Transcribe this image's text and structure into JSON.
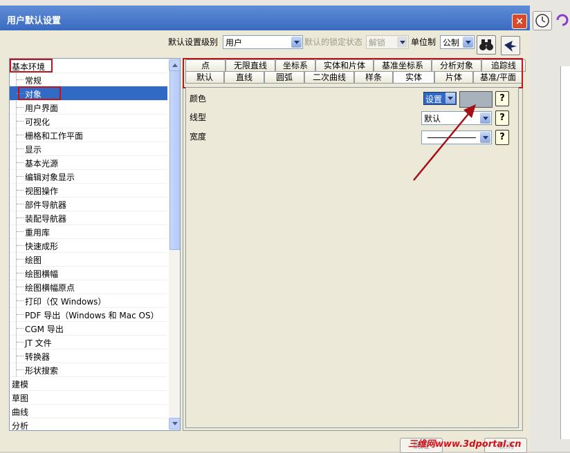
{
  "window": {
    "title": "用户默认设置",
    "close_label": "×"
  },
  "toolbar": {
    "level_label": "默认设置级别",
    "level_value": "用户",
    "lock_label": "默认的锁定状态",
    "lock_value": "解锁",
    "unit_label": "单位制",
    "unit_value": "公制"
  },
  "tree": {
    "root": "基本环境",
    "children": [
      "常规",
      "对象",
      "用户界面",
      "可视化",
      "栅格和工作平面",
      "显示",
      "基本光源",
      "编辑对象显示",
      "视图操作",
      "部件导航器",
      "装配导航器",
      "重用库",
      "快速成形",
      "绘图",
      "绘图横幅",
      "绘图横幅原点",
      "打印（仅 Windows）",
      "PDF 导出（Windows 和 Mac OS）",
      "CGM 导出",
      "JT 文件",
      "转换器",
      "形状搜索"
    ],
    "selected": "对象",
    "others": [
      "建模",
      "草图",
      "曲线",
      "分析"
    ]
  },
  "tabs": {
    "row1": [
      "点",
      "无限直线",
      "坐标系",
      "实体和片体",
      "基准坐标系",
      "分析对象",
      "追踪线"
    ],
    "row2": [
      "默认",
      "直线",
      "圆弧",
      "二次曲线",
      "样条",
      "实体",
      "片体",
      "基准/平面"
    ],
    "active": "实体"
  },
  "props": {
    "color_label": "颜色",
    "color_value": "设置",
    "color_swatch": "#a7b2bd",
    "linetype_label": "线型",
    "linetype_value": "默认",
    "width_label": "宽度",
    "help": "?"
  },
  "buttons": {
    "ok": "确定",
    "cancel": "取消"
  },
  "watermark": "三维网www.3dportal.cn",
  "colors": {
    "highlight": "#c0141c",
    "selection": "#316ac5"
  }
}
